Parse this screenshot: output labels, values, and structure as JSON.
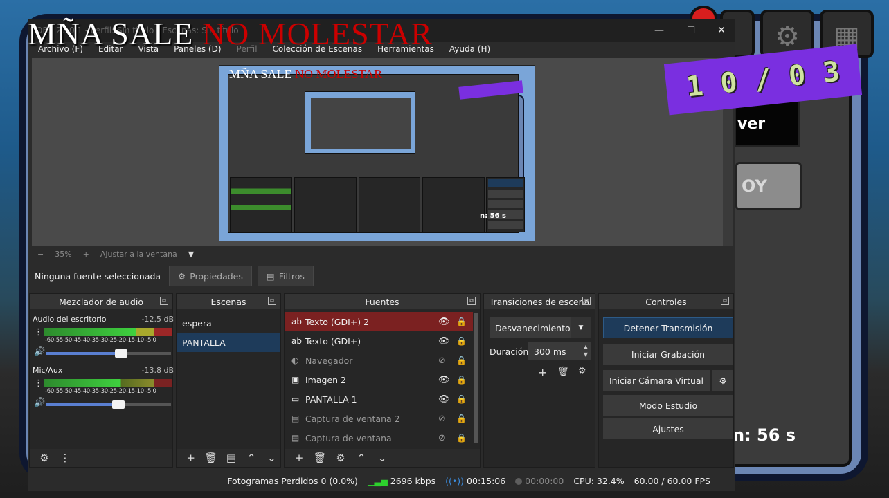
{
  "overlay": {
    "title_white": "MÑA SALE",
    "title_red": "NO MOLESTAR",
    "banner_chars": [
      "1",
      "0",
      "/",
      "0",
      "3"
    ]
  },
  "window": {
    "title": "OBS 27.0.1 - Perfil: Sin título - Escenas: Sin título",
    "minimize": "—",
    "maximize": "☐",
    "close": "✕"
  },
  "menu": [
    {
      "label": "Archivo (F)"
    },
    {
      "label": "Editar"
    },
    {
      "label": "Vista"
    },
    {
      "label": "Paneles (D)"
    },
    {
      "label": "Perfil"
    },
    {
      "label": "Colección de Escenas"
    },
    {
      "label": "Herramientas"
    },
    {
      "label": "Ayuda (H)"
    }
  ],
  "zoom": {
    "minus": "−",
    "value": "35%",
    "plus": "+",
    "fit": "Ajustar a la ventana",
    "arrow": "▼"
  },
  "source_toolbar": {
    "no_source": "Ninguna fuente seleccionada",
    "properties": "Propiedades",
    "filters": "Filtros"
  },
  "docks": {
    "mixer": "Mezclador de audio",
    "scenes": "Escenas",
    "sources": "Fuentes",
    "transitions": "Transiciones de escena",
    "controls": "Controles"
  },
  "mixer": {
    "tracks": [
      {
        "name": "Audio del escritorio",
        "db": "-12.5 dB",
        "volume": 0.6
      },
      {
        "name": "Mic/Aux",
        "db": "-13.8 dB",
        "volume": 0.58
      }
    ],
    "scale": "-60-55-50-45-40-35-30-25-20-15-10 -5  0"
  },
  "scenes": [
    {
      "name": "espera",
      "selected": false
    },
    {
      "name": "PANTALLA",
      "selected": true
    }
  ],
  "sources": [
    {
      "name": "Texto (GDI+) 2",
      "icon": "text-icon",
      "visible": true,
      "selected": true
    },
    {
      "name": "Texto (GDI+)",
      "icon": "text-icon",
      "visible": true,
      "selected": false
    },
    {
      "name": "Navegador",
      "icon": "browser-icon",
      "visible": false,
      "selected": false
    },
    {
      "name": "Imagen 2",
      "icon": "image-icon",
      "visible": true,
      "selected": false
    },
    {
      "name": "PANTALLA 1",
      "icon": "monitor-icon",
      "visible": true,
      "selected": false
    },
    {
      "name": "Captura de ventana 2",
      "icon": "window-icon",
      "visible": false,
      "selected": false
    },
    {
      "name": "Captura de ventana",
      "icon": "window-icon",
      "visible": false,
      "selected": false
    }
  ],
  "transitions": {
    "selected": "Desvanecimiento",
    "duration_label": "Duración",
    "duration": "300 ms"
  },
  "controls": {
    "stop_stream": "Detener Transmisión",
    "start_recording": "Iniciar Grabación",
    "virtual_cam": "Iniciar Cámara Virtual",
    "studio_mode": "Modo Estudio",
    "settings": "Ajustes"
  },
  "status": {
    "dropped": "Fotogramas Perdidos 0 (0.0%)",
    "bitrate": "2696 kbps",
    "stream_time": "00:15:06",
    "rec_time": "00:00:00",
    "cpu": "CPU: 32.4%",
    "fps": "60.00 / 60.00 FPS"
  },
  "background": {
    "text_1": "ver",
    "text_2": "OY",
    "timer": "n: 56 s"
  },
  "preview_inner": {
    "timer": "n: 56 s"
  },
  "colors": {
    "accent_blue": "#1e3b5a",
    "selected_red": "#7b2121",
    "meter_green": "#3fd13f"
  }
}
